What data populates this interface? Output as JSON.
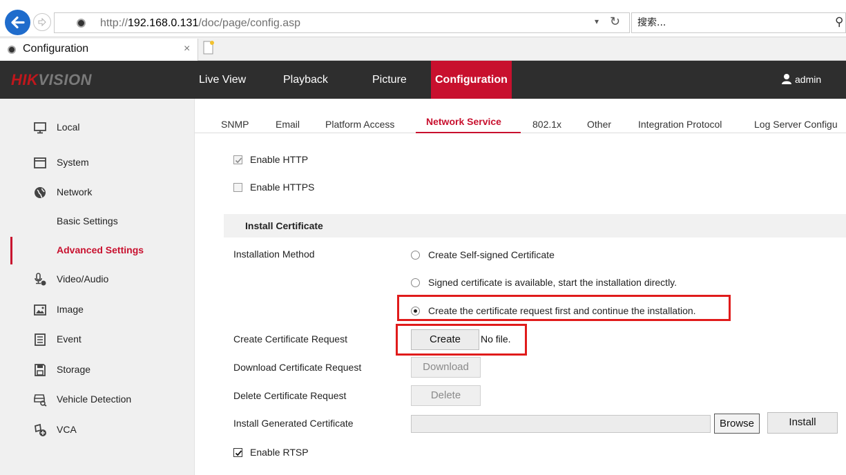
{
  "browser": {
    "url_prefix": "http://",
    "url_host": "192.168.0.131",
    "url_path": "/doc/page/config.asp",
    "search_placeholder": "搜索...",
    "tab_title": "Configuration",
    "tab_close": "×"
  },
  "header": {
    "logo_red": "HIK",
    "logo_rest": "VISION",
    "nav": [
      {
        "label": "Live View"
      },
      {
        "label": "Playback"
      },
      {
        "label": "Picture"
      },
      {
        "label": "Configuration"
      }
    ],
    "user": "admin"
  },
  "sidebar": {
    "items": [
      {
        "label": "Local",
        "icon": "monitor-icon"
      },
      {
        "label": "System",
        "icon": "system-icon"
      },
      {
        "label": "Network",
        "icon": "globe-icon"
      },
      {
        "label": "Basic Settings"
      },
      {
        "label": "Advanced Settings"
      },
      {
        "label": "Video/Audio",
        "icon": "microphone-icon"
      },
      {
        "label": "Image",
        "icon": "image-icon"
      },
      {
        "label": "Event",
        "icon": "event-icon"
      },
      {
        "label": "Storage",
        "icon": "storage-icon"
      },
      {
        "label": "Vehicle Detection",
        "icon": "vehicle-icon"
      },
      {
        "label": "VCA",
        "icon": "vca-icon"
      }
    ]
  },
  "subtabs": [
    {
      "label": "SNMP"
    },
    {
      "label": "Email"
    },
    {
      "label": "Platform Access"
    },
    {
      "label": "Network Service"
    },
    {
      "label": "802.1x"
    },
    {
      "label": "Other"
    },
    {
      "label": "Integration Protocol"
    },
    {
      "label": "Log Server Configu"
    }
  ],
  "form": {
    "enable_http": "Enable HTTP",
    "enable_https": "Enable HTTPS",
    "section_title": "Install Certificate",
    "installation_method": "Installation Method",
    "radio_options": [
      "Create Self-signed Certificate",
      "Signed certificate is available, start the installation directly.",
      "Create the certificate request first and continue the installation."
    ],
    "create_request_label": "Create Certificate Request",
    "create_button": "Create",
    "no_file": "No file.",
    "download_label": "Download Certificate Request",
    "download_button": "Download",
    "delete_label": "Delete Certificate Request",
    "delete_button": "Delete",
    "install_label": "Install Generated Certificate",
    "browse_button": "Browse",
    "install_button": "Install",
    "enable_rtsp": "Enable RTSP"
  },
  "colors": {
    "accent": "#c8102e",
    "highlight": "#e01b1b",
    "header_bg": "#2e2e2e"
  }
}
